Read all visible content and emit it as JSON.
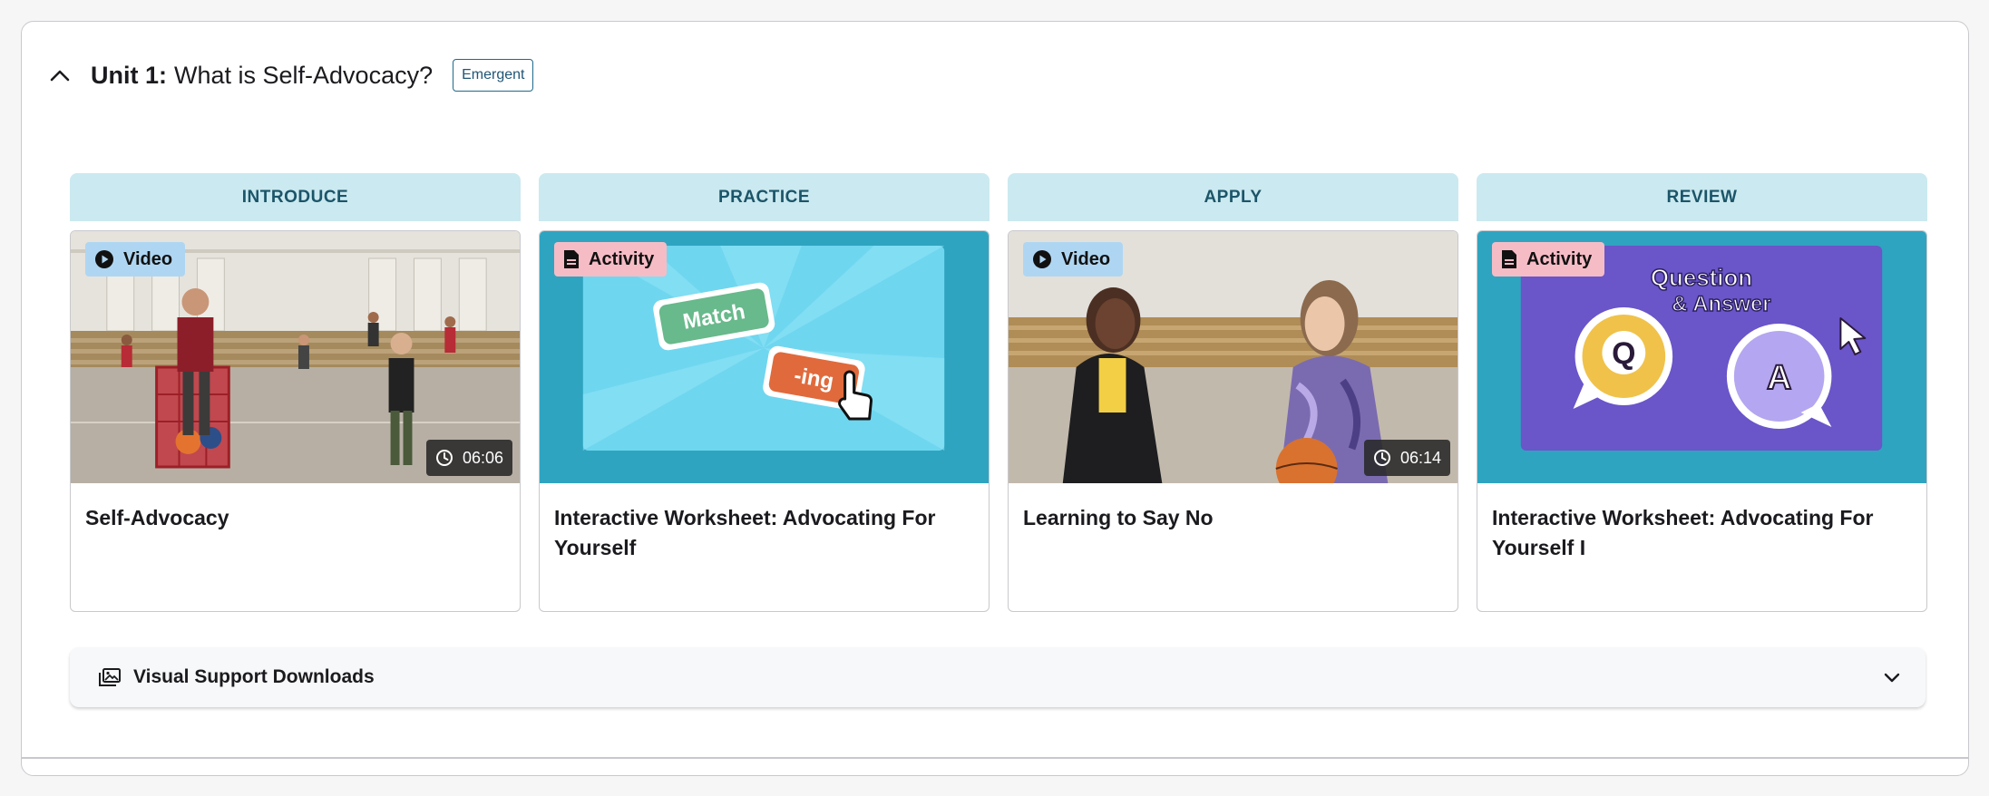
{
  "unit": {
    "number_label": "Unit 1:",
    "title": "What is Self-Advocacy?",
    "level_badge": "Emergent"
  },
  "stages": [
    {
      "label": "INTRODUCE",
      "card": {
        "type_label": "Video",
        "type_icon": "play-circle-icon",
        "duration": "06:06",
        "title": "Self-Advocacy"
      }
    },
    {
      "label": "PRACTICE",
      "card": {
        "type_label": "Activity",
        "type_icon": "document-icon",
        "title": "Interactive Worksheet: Advocating For Yourself",
        "art_text_1": "Match",
        "art_text_2": "-ing"
      }
    },
    {
      "label": "APPLY",
      "card": {
        "type_label": "Video",
        "type_icon": "play-circle-icon",
        "duration": "06:14",
        "title": "Learning to Say No"
      }
    },
    {
      "label": "REVIEW",
      "card": {
        "type_label": "Activity",
        "type_icon": "document-icon",
        "title": "Interactive Worksheet: Advocating For Yourself I",
        "art_text_1": "Question",
        "art_text_2": "& Answer",
        "art_q": "Q",
        "art_a": "A"
      }
    }
  ],
  "downloads": {
    "label": "Visual Support Downloads"
  },
  "colors": {
    "stage_header_bg": "#cbe9f0",
    "stage_header_text": "#1b5569",
    "video_badge": "#aed6f2",
    "activity_badge": "#f6bcc6",
    "level_badge_border": "#1f6a8a"
  }
}
